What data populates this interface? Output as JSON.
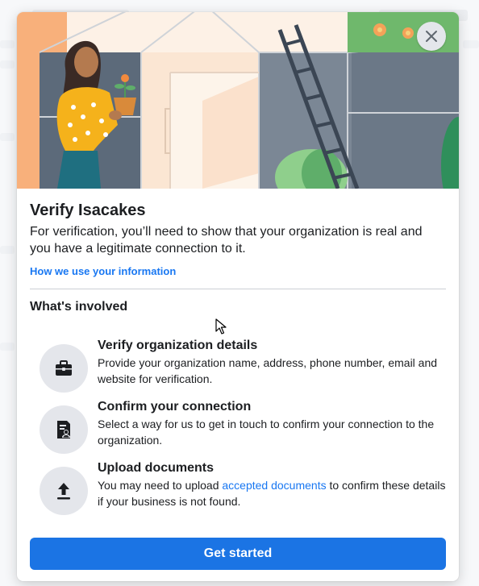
{
  "modal": {
    "title": "Verify Isacakes",
    "description": "For verification, you’ll need to show that your organization is real and you have a legitimate connection to it.",
    "info_link": "How we use your information",
    "section_title": "What's involved",
    "close_icon": "close-icon",
    "steps": [
      {
        "icon": "briefcase-icon",
        "title": "Verify organization details",
        "description": "Provide your organization name, address, phone number, email and website for verification."
      },
      {
        "icon": "document-person-icon",
        "title": "Confirm your connection",
        "description": "Select a way for us to get in touch to confirm your connection to the organization."
      },
      {
        "icon": "upload-icon",
        "title": "Upload documents",
        "description_before": "You may need to upload ",
        "description_link": "accepted documents",
        "description_after": " to confirm these details if your business is not found."
      }
    ],
    "primary_button": "Get started"
  },
  "colors": {
    "accent": "#1877f2",
    "button": "#1b74e4",
    "icon_circle": "#e4e6eb"
  }
}
